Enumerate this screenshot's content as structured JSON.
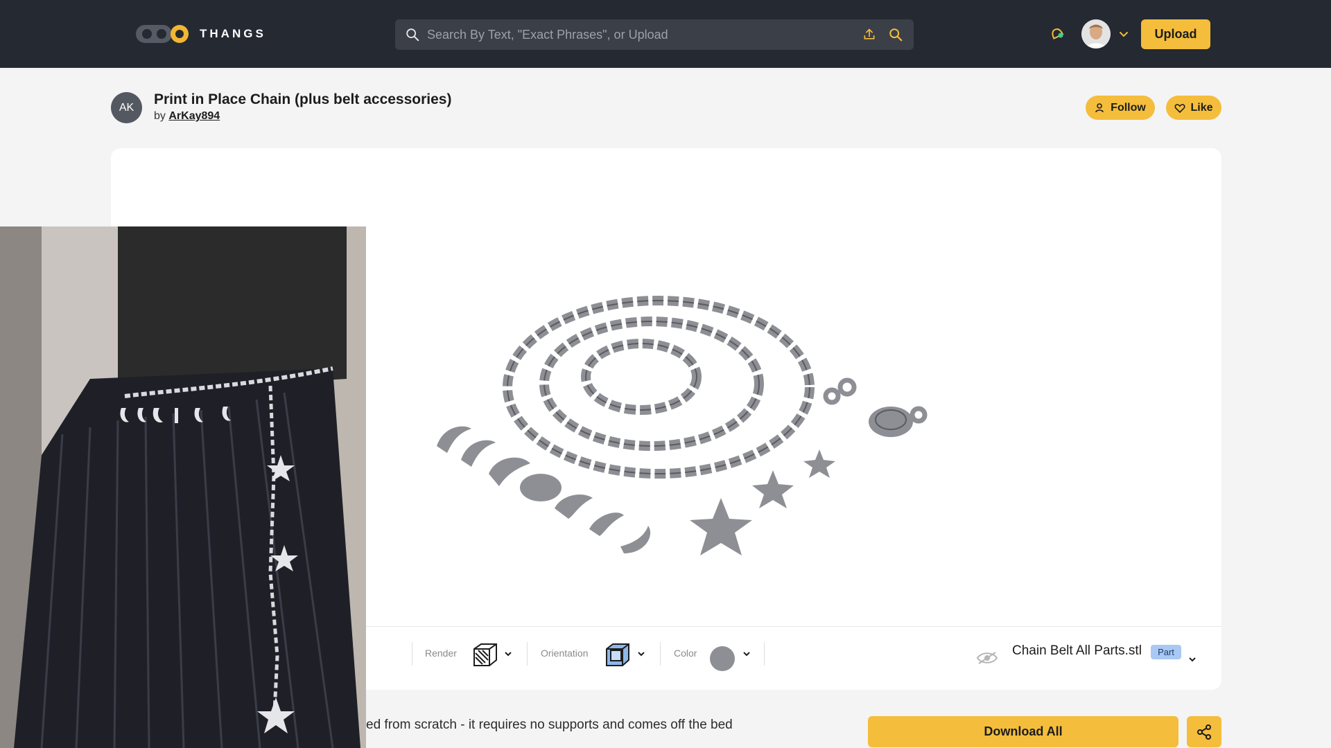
{
  "app": {
    "logo_text": "THANGS"
  },
  "search": {
    "placeholder": "Search By Text, \"Exact Phrases\", or Upload"
  },
  "header": {
    "upload_label": "Upload"
  },
  "model": {
    "author_initials": "AK",
    "title": "Print in Place Chain (plus belt accessories)",
    "by_label": "by",
    "author": "ArKay894",
    "follow_label": "Follow",
    "like_label": "Like"
  },
  "viewer_toolbar": {
    "render_label": "Render",
    "orientation_label": "Orientation",
    "color_label": "Color",
    "file_name": "Chain Belt All Parts.stl",
    "badge": "Part"
  },
  "description_snippet": "ed from scratch - it requires no supports and comes off the bed",
  "download_label": "Download All",
  "colors": {
    "accent": "#f4bd3b",
    "nav_bg": "#252932",
    "model_gray": "#8e8f94"
  }
}
